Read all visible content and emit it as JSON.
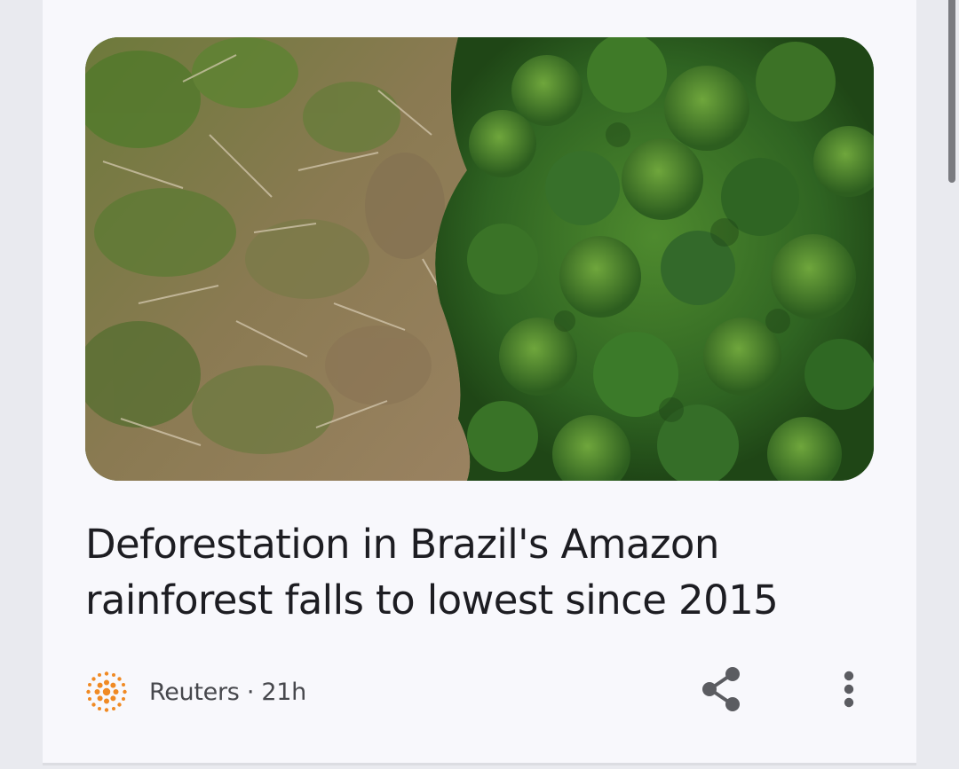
{
  "article": {
    "headline": "Deforestation in Brazil's Amazon rainforest falls to lowest since 2015",
    "source": "Reuters",
    "age": "21h",
    "byline": "Reuters · 21h"
  },
  "icons": {
    "source_logo": "reuters-logo-icon",
    "share": "share-icon",
    "more": "more-vert-icon"
  },
  "colors": {
    "background": "#e9eaef",
    "card": "#f8f8fc",
    "headline_text": "#1d1d22",
    "meta_text": "#47484d",
    "icon": "#5b5c61",
    "logo_orange": "#f08a24"
  }
}
